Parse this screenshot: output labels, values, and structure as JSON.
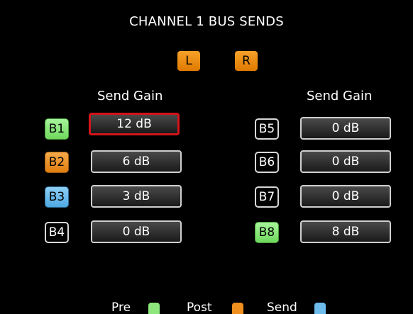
{
  "header": {
    "title": "CHANNEL 1 BUS SENDS"
  },
  "toggles": {
    "left": "L",
    "right": "R"
  },
  "columns": {
    "left_label": "Send Gain",
    "right_label": "Send Gain"
  },
  "buses": [
    {
      "label": "B1",
      "gain": "12 dB",
      "mode": "pre"
    },
    {
      "label": "B2",
      "gain": "6 dB",
      "mode": "post"
    },
    {
      "label": "B3",
      "gain": "3 dB",
      "mode": "send"
    },
    {
      "label": "B4",
      "gain": "0 dB",
      "mode": "none"
    },
    {
      "label": "B5",
      "gain": "0 dB",
      "mode": "none"
    },
    {
      "label": "B6",
      "gain": "0 dB",
      "mode": "none"
    },
    {
      "label": "B7",
      "gain": "0 dB",
      "mode": "none"
    },
    {
      "label": "B8",
      "gain": "8 dB",
      "mode": "pre"
    }
  ],
  "selected_bus": "B1",
  "legend": {
    "pre": "Pre",
    "post": "Post",
    "send": "Send"
  },
  "colors": {
    "pre": "#8ee77d",
    "post": "#ef8f1f",
    "send": "#6dbcec",
    "selection": "#d4141a"
  }
}
